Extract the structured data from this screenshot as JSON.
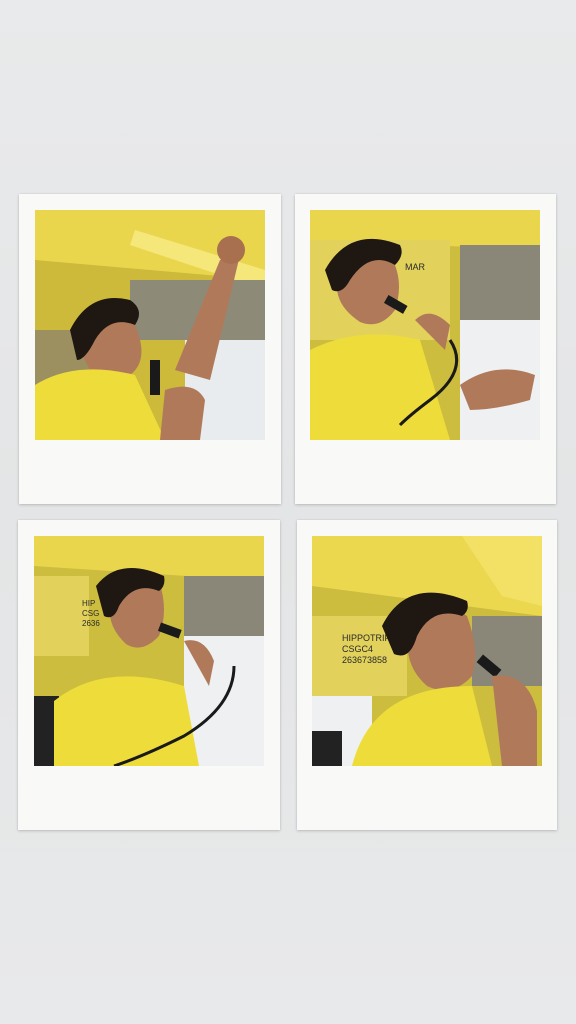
{
  "collage": {
    "photos": [
      {
        "scene": "guide-arm-raised",
        "signage": []
      },
      {
        "scene": "guide-speaking-mic",
        "signage": [
          "MAR"
        ]
      },
      {
        "scene": "guide-looking-down",
        "signage": [
          "HIP",
          "CSG",
          "2636"
        ]
      },
      {
        "scene": "guide-shouting",
        "signage": [
          "HIPPOTRIP MAR",
          "CSGC4",
          "263673858"
        ]
      }
    ],
    "colors": {
      "background": "#e6e7e8",
      "frame": "#f9f9f8",
      "ceiling": "#e8d64a",
      "shirt": "#eedc3a",
      "skin": "#b07a5a",
      "hair": "#1e1712"
    }
  }
}
